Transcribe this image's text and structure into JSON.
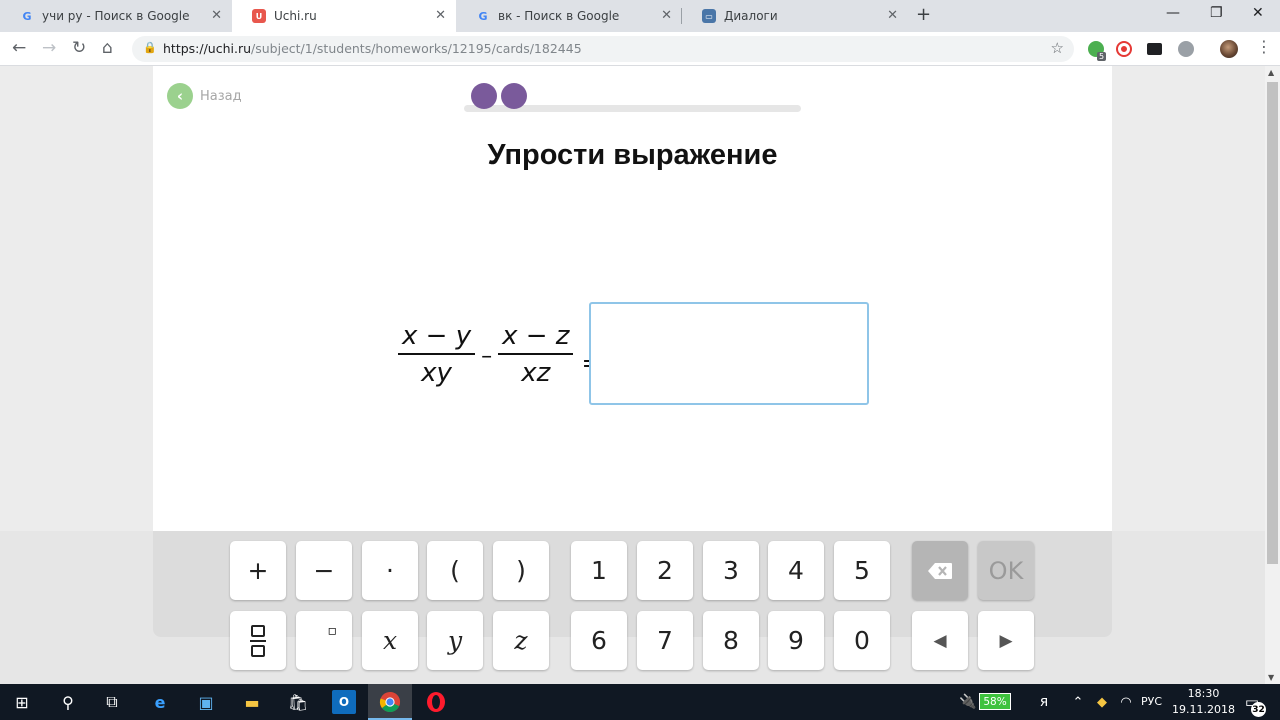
{
  "browser": {
    "tabs": [
      {
        "title": "учи ру - Поиск в Google",
        "favicon": "google-icon",
        "active": false
      },
      {
        "title": "Uchi.ru",
        "favicon": "uchi-icon",
        "active": true
      },
      {
        "title": "вк - Поиск в Google",
        "favicon": "google-icon",
        "active": false
      },
      {
        "title": "Диалоги",
        "favicon": "vk-icon",
        "active": false
      }
    ],
    "url_host": "https://uchi.ru",
    "url_path": "/subject/1/students/homeworks/12195/cards/182445",
    "extension_badge": "5"
  },
  "page": {
    "back_label": "Назад",
    "title": "Упрости выражение",
    "progress": {
      "filled_dots": 2
    },
    "expression": {
      "frac1_num": "x − y",
      "frac1_den": "xy",
      "operator": "–",
      "frac2_num": "x − z",
      "frac2_den": "xz",
      "equals": "="
    },
    "answer_value": ""
  },
  "keyboard": {
    "row1": [
      "+",
      "−",
      "·",
      "(",
      ")",
      "1",
      "2",
      "3",
      "4",
      "5"
    ],
    "row2": [
      "x",
      "y",
      "z",
      "6",
      "7",
      "8",
      "9",
      "0"
    ],
    "ok_label": "OK",
    "left_arrow": "◀",
    "right_arrow": "▶"
  },
  "taskbar": {
    "battery": "58%",
    "language": "РУС",
    "time": "18:30",
    "date": "19.11.2018",
    "notifications": "32"
  },
  "colors": {
    "accent_purple": "#7a5a9b",
    "back_green": "#9bd18e",
    "input_border": "#8fc5e8",
    "battery_green": "#3ec23e"
  }
}
